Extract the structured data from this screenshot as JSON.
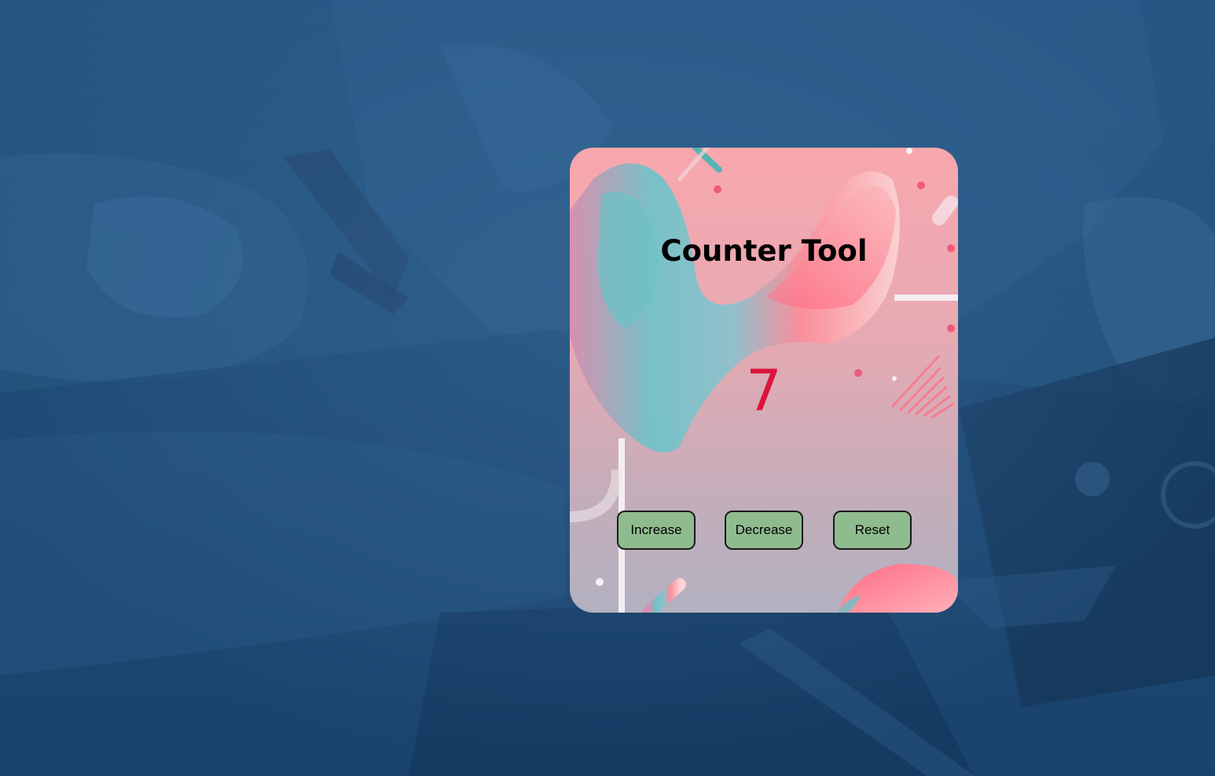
{
  "app": {
    "title": "Counter Tool",
    "count": "7"
  },
  "buttons": {
    "increase_label": "Increase",
    "decrease_label": "Decrease",
    "reset_label": "Reset"
  },
  "colors": {
    "backdrop_overlay": "#1e4a74",
    "button_background": "#8fbc8f",
    "count_color": "#dc143c",
    "title_color": "#000000"
  }
}
